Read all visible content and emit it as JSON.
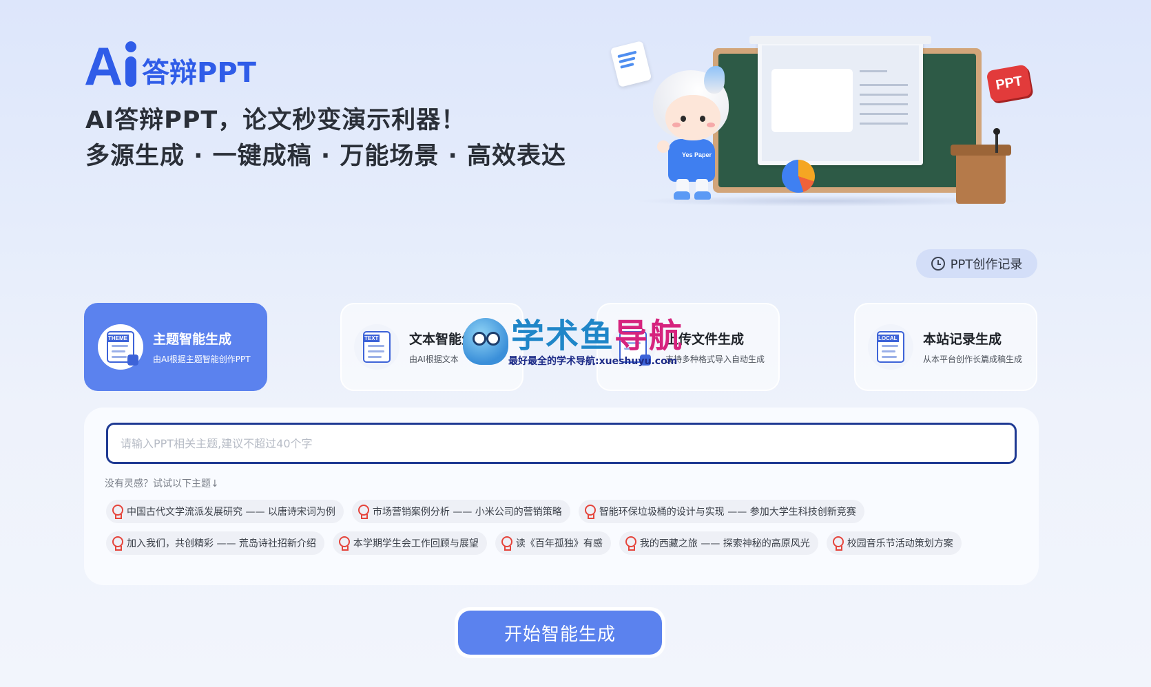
{
  "brand": {
    "logo_mark": "Ai",
    "name": "答辩PPT"
  },
  "hero": {
    "title": "AI答辩PPT，论文秒变演示利器！",
    "subtitle": "多源生成 · 一键成稿 · 万能场景 · 高效表达"
  },
  "illustration": {
    "badge_text": "PPT",
    "shirt_text": "Yes Paper"
  },
  "history_button": {
    "label": "PPT创作记录",
    "icon": "clock-icon"
  },
  "modes": [
    {
      "title": "主题智能生成",
      "desc": "由AI根据主题智能创作PPT",
      "tag": "THEME",
      "icon": "theme-doc-icon",
      "active": true
    },
    {
      "title": "文本智能生成",
      "desc": "由AI根据文本",
      "tag": "TEXT",
      "icon": "text-doc-icon",
      "active": false
    },
    {
      "title": "上传文件生成",
      "desc": "支持多种格式导入自动生成",
      "tag": "",
      "icon": "upload-icon",
      "active": false
    },
    {
      "title": "本站记录生成",
      "desc": "从本平台创作长篇成稿生成",
      "tag": "LOCAL",
      "icon": "local-monitor-icon",
      "active": false
    }
  ],
  "watermark": {
    "title_part1": "学术鱼",
    "title_part2": "导航",
    "tagline": "最好最全的学术导航:xueshuyu.com"
  },
  "input": {
    "value": "",
    "placeholder": "请输入PPT相关主题,建议不超过40个字"
  },
  "suggestions": {
    "hint": "没有灵感？试试以下主题↓",
    "items": [
      "中国古代文学流派发展研究 —— 以唐诗宋词为例",
      "市场营销案例分析 —— 小米公司的营销策略",
      "智能环保垃圾桶的设计与实现 —— 参加大学生科技创新竞赛",
      "加入我们，共创精彩 —— 荒岛诗社招新介绍",
      "本学期学生会工作回顾与展望",
      "读《百年孤独》有感",
      "我的西藏之旅 —— 探索神秘的高原风光",
      "校园音乐节活动策划方案"
    ]
  },
  "generate_button": {
    "label": "开始智能生成"
  },
  "colors": {
    "brand_blue": "#2f5ce8",
    "active_card": "#5b82ee",
    "input_border": "#1f3a93",
    "bulb_red": "#e5443b"
  }
}
